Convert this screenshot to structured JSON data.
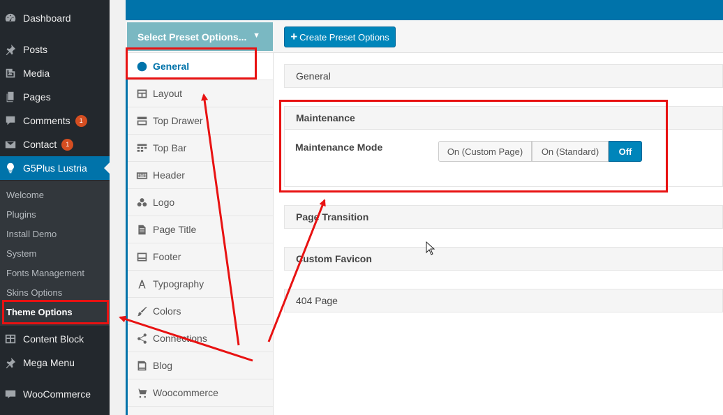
{
  "admin_menu": {
    "items": [
      {
        "label": "Dashboard",
        "icon": "dashboard-icon"
      },
      {
        "label": "Posts",
        "icon": "pin-icon"
      },
      {
        "label": "Media",
        "icon": "media-icon"
      },
      {
        "label": "Pages",
        "icon": "pages-icon"
      },
      {
        "label": "Comments",
        "icon": "comments-icon",
        "badge": "1"
      },
      {
        "label": "Contact",
        "icon": "envelope-icon",
        "badge": "1"
      },
      {
        "label": "G5Plus Lustria",
        "icon": "lightbulb-icon"
      },
      {
        "label": "Content Block",
        "icon": "table-icon"
      },
      {
        "label": "Mega Menu",
        "icon": "pin-icon"
      },
      {
        "label": "WooCommerce",
        "icon": "woo-icon"
      }
    ],
    "submenu": [
      "Welcome",
      "Plugins",
      "Install Demo",
      "System",
      "Fonts Management",
      "Skins Options",
      "Theme Options"
    ]
  },
  "toolbar": {
    "preset_select": "Select Preset Options...",
    "create_button": "Create Preset Options",
    "create_button_prefix": "+"
  },
  "sections_nav": [
    {
      "label": "General",
      "icon": "globe-icon"
    },
    {
      "label": "Layout",
      "icon": "layout-icon"
    },
    {
      "label": "Top Drawer",
      "icon": "drawer-icon"
    },
    {
      "label": "Top Bar",
      "icon": "topbar-icon"
    },
    {
      "label": "Header",
      "icon": "keyboard-icon"
    },
    {
      "label": "Logo",
      "icon": "circles-icon"
    },
    {
      "label": "Page Title",
      "icon": "document-icon"
    },
    {
      "label": "Footer",
      "icon": "footer-icon"
    },
    {
      "label": "Typography",
      "icon": "font-icon"
    },
    {
      "label": "Colors",
      "icon": "brush-icon"
    },
    {
      "label": "Connections",
      "icon": "share-icon"
    },
    {
      "label": "Blog",
      "icon": "blog-icon"
    },
    {
      "label": "Woocommerce",
      "icon": "cart-icon"
    }
  ],
  "content": {
    "general_title": "General",
    "maintenance_title": "Maintenance",
    "maintenance_mode_label": "Maintenance Mode",
    "maintenance_options": [
      "On (Custom Page)",
      "On (Standard)",
      "Off"
    ],
    "maintenance_selected": "Off",
    "page_transition_title": "Page Transition",
    "custom_favicon_title": "Custom Favicon",
    "page_404_title": "404 Page"
  },
  "colors": {
    "admin_bg": "#23282d",
    "accent": "#0073aa",
    "annotation": "#e81212"
  }
}
